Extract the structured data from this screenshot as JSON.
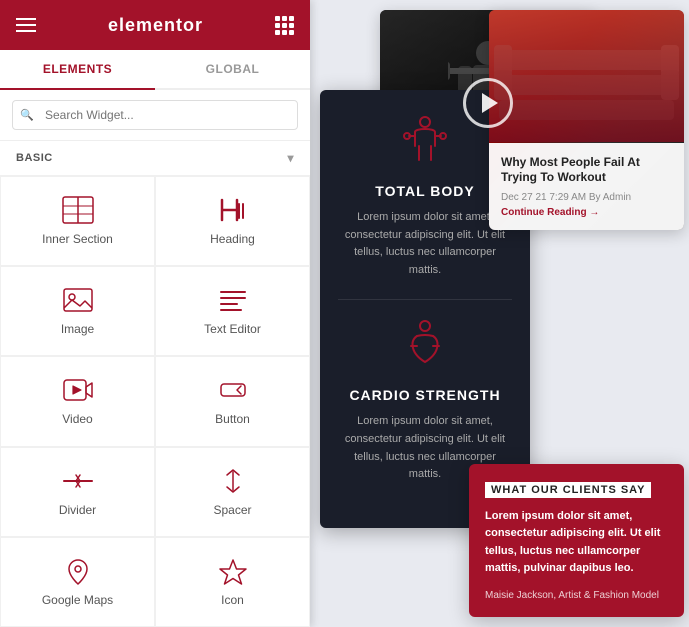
{
  "sidebar": {
    "header": {
      "logo": "elementor",
      "hamburger_label": "menu",
      "grid_label": "apps"
    },
    "tabs": [
      {
        "id": "elements",
        "label": "ELEMENTS",
        "active": true
      },
      {
        "id": "global",
        "label": "GLOBAL",
        "active": false
      }
    ],
    "search": {
      "placeholder": "Search Widget..."
    },
    "section": {
      "label": "BASIC",
      "chevron": "▾"
    },
    "widgets": [
      {
        "id": "inner-section",
        "label": "Inner Section",
        "icon": "inner-section-icon"
      },
      {
        "id": "heading",
        "label": "Heading",
        "icon": "heading-icon"
      },
      {
        "id": "image",
        "label": "Image",
        "icon": "image-icon"
      },
      {
        "id": "text-editor",
        "label": "Text Editor",
        "icon": "text-editor-icon"
      },
      {
        "id": "video",
        "label": "Video",
        "icon": "video-icon"
      },
      {
        "id": "button",
        "label": "Button",
        "icon": "button-icon"
      },
      {
        "id": "divider",
        "label": "Divider",
        "icon": "divider-icon"
      },
      {
        "id": "spacer",
        "label": "Spacer",
        "icon": "spacer-icon"
      },
      {
        "id": "google-maps",
        "label": "Google Maps",
        "icon": "map-icon"
      },
      {
        "id": "icon",
        "label": "Icon",
        "icon": "star-icon"
      }
    ]
  },
  "preview": {
    "gym_video": {
      "alt": "Gym workout video thumbnail"
    },
    "card_dark_1": {
      "icon": "💪",
      "title": "TOTAL BODY",
      "description": "Lorem ipsum dolor sit amet, consectetur adipiscing elit. Ut elit tellus, luctus nec ullamcorper mattis."
    },
    "card_dark_2": {
      "icon": "🏋️",
      "title": "CARDIO STRENGTH",
      "description": "Lorem ipsum dolor sit amet, consectetur adipiscing elit. Ut elit tellus, luctus nec ullamcorper mattis."
    },
    "blog_post": {
      "title": "Why Most People Fail At Trying To Workout",
      "date": "Dec 27 21",
      "time": "7:29 AM",
      "author": "By Admin",
      "read_more": "Continue Reading"
    },
    "testimonial": {
      "section_label": "WHAT OUR CLIENTS SAY",
      "quote": "Lorem ipsum dolor sit amet, consectetur adipiscing elit. Ut elit tellus, luctus nec ullamcorper mattis, pulvinar dapibus leo.",
      "author": "Maisie Jackson, Artist & Fashion Model"
    }
  }
}
